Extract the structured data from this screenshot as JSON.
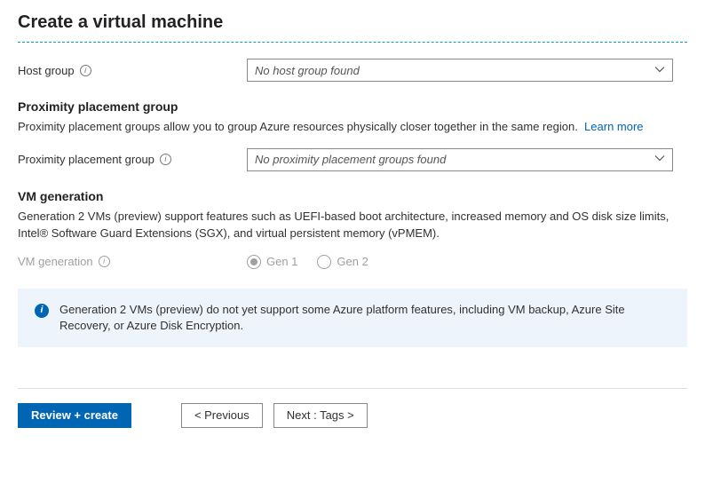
{
  "page_title": "Create a virtual machine",
  "host_group": {
    "label": "Host group",
    "value": "No host group found"
  },
  "proximity": {
    "heading": "Proximity placement group",
    "description": "Proximity placement groups allow you to group Azure resources physically closer together in the same region.",
    "learn_more": "Learn more",
    "field_label": "Proximity placement group",
    "value": "No proximity placement groups found"
  },
  "vm_generation": {
    "heading": "VM generation",
    "description": "Generation 2 VMs (preview) support features such as UEFI-based boot architecture, increased memory and OS disk size limits, Intel® Software Guard Extensions (SGX), and virtual persistent memory (vPMEM).",
    "field_label": "VM generation",
    "options": {
      "gen1": "Gen 1",
      "gen2": "Gen 2"
    },
    "selected": "gen1"
  },
  "notice": "Generation 2 VMs (preview) do not yet support some Azure platform features, including VM backup, Azure Site Recovery, or Azure Disk Encryption.",
  "footer": {
    "review": "Review + create",
    "previous": "<  Previous",
    "next": "Next : Tags  >"
  }
}
